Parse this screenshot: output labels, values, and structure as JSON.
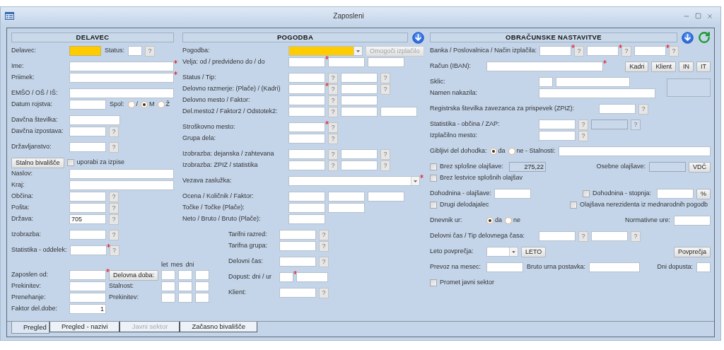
{
  "window": {
    "title": "Zaposleni"
  },
  "columns": [
    {
      "title": "DELAVEC",
      "groups": [
        {
          "kind": "plain",
          "rows": [
            {
              "label": "Delavec:",
              "items": [
                {
                  "kind": "smallbox",
                  "highlighted": true
                },
                {
                  "kind": "text",
                  "text": "Status:"
                },
                {
                  "kind": "minibox"
                },
                {
                  "kind": "help",
                  "label": "?"
                }
              ]
            }
          ]
        },
        {
          "kind": "plain",
          "rows": [
            {
              "label": "Ime:",
              "items": [
                {
                  "kind": "bar",
                  "required": true
                }
              ]
            },
            {
              "label": "Priimek:",
              "items": [
                {
                  "kind": "bar",
                  "required": true
                }
              ]
            }
          ]
        },
        {
          "kind": "plain",
          "rows": [
            {
              "label": "EMŠO / OŠ / IŠ:",
              "items": [
                {
                  "kind": "bar"
                }
              ]
            },
            {
              "label": "Datum rojstva:",
              "items": [
                {
                  "kind": "box"
                },
                {
                  "kind": "text",
                  "text": "Spol:"
                },
                {
                  "kind": "radio",
                  "label": "/",
                  "selected": false
                },
                {
                  "kind": "radio",
                  "label": "M",
                  "selected": true
                },
                {
                  "kind": "radio",
                  "label": "Ž",
                  "selected": false
                }
              ]
            }
          ]
        },
        {
          "kind": "plain",
          "rows": [
            {
              "label": "Davčna številka:",
              "items": [
                {
                  "kind": "midbox"
                }
              ]
            },
            {
              "label": "Davčna izpostava:",
              "items": [
                {
                  "kind": "box"
                },
                {
                  "kind": "help",
                  "label": "?"
                }
              ]
            }
          ]
        },
        {
          "kind": "plain",
          "rows": [
            {
              "label": "Državljanstvo:",
              "items": [
                {
                  "kind": "box"
                },
                {
                  "kind": "help",
                  "label": "?"
                }
              ]
            }
          ]
        },
        {
          "kind": "plain",
          "rows": [
            {
              "items": [
                {
                  "kind": "button",
                  "label": "Stalno bivališče"
                },
                {
                  "kind": "check",
                  "label": "uporabi za izpise",
                  "checked": false
                }
              ]
            },
            {
              "label": "Naslov:",
              "items": [
                {
                  "kind": "bar"
                }
              ]
            },
            {
              "label": "Kraj:",
              "items": [
                {
                  "kind": "bar"
                }
              ]
            },
            {
              "label": "Občina:",
              "items": [
                {
                  "kind": "box"
                },
                {
                  "kind": "help",
                  "label": "?"
                }
              ]
            },
            {
              "label": "Pošta:",
              "items": [
                {
                  "kind": "box"
                },
                {
                  "kind": "help",
                  "label": "?"
                }
              ]
            },
            {
              "label": "Država:",
              "items": [
                {
                  "kind": "box",
                  "value": "705"
                },
                {
                  "kind": "help",
                  "label": "?"
                }
              ]
            }
          ]
        },
        {
          "kind": "plain",
          "rows": [
            {
              "label": "Izobrazba:",
              "items": [
                {
                  "kind": "box"
                },
                {
                  "kind": "help",
                  "label": "?"
                }
              ]
            }
          ]
        },
        {
          "kind": "plain",
          "rows": [
            {
              "label": "Statistika - oddelek:",
              "items": [
                {
                  "kind": "box",
                  "required": true
                },
                {
                  "kind": "help",
                  "label": "?"
                }
              ]
            }
          ]
        },
        {
          "kind": "duration",
          "rows": [
            {
              "kind": "heads",
              "items": [
                {
                  "kind": "text",
                  "text": "let"
                },
                {
                  "kind": "text",
                  "text": "mes"
                },
                {
                  "kind": "text",
                  "text": "dni"
                }
              ]
            },
            {
              "kind": "line",
              "label": "Zaposlen od:",
              "items": [
                {
                  "kind": "box",
                  "required": true
                },
                {
                  "kind": "button",
                  "label": "Delovna doba:"
                },
                {
                  "kind": "minibox"
                },
                {
                  "kind": "minibox"
                },
                {
                  "kind": "minibox"
                }
              ]
            },
            {
              "kind": "line",
              "label": "Prekinitev:",
              "items": [
                {
                  "kind": "box"
                },
                {
                  "kind": "text",
                  "text": "Stalnost:"
                },
                {
                  "kind": "minibox"
                },
                {
                  "kind": "minibox"
                },
                {
                  "kind": "minibox"
                }
              ]
            },
            {
              "kind": "line",
              "label": "Prenehanje:",
              "items": [
                {
                  "kind": "box"
                },
                {
                  "kind": "text",
                  "text": "Prekinitev:"
                },
                {
                  "kind": "minibox"
                },
                {
                  "kind": "minibox"
                },
                {
                  "kind": "minibox"
                }
              ]
            },
            {
              "kind": "line",
              "label": "Faktor del.dobe:",
              "items": [
                {
                  "kind": "box",
                  "value": "1"
                }
              ]
            }
          ]
        }
      ]
    },
    {
      "title": "POGODBA",
      "header_icons": [
        {
          "kind": "down"
        }
      ],
      "groups": [
        {
          "kind": "plain",
          "rows": [
            {
              "label": "Pogodba:",
              "items": [
                {
                  "kind": "dropdown",
                  "highlighted": true
                },
                {
                  "kind": "button",
                  "label": "Omogoči izplačilo",
                  "disabled": true
                }
              ]
            },
            {
              "label": "Velja: od / predvideno do / do",
              "items": [
                {
                  "kind": "box",
                  "required": true
                },
                {
                  "kind": "box"
                },
                {
                  "kind": "box"
                }
              ]
            }
          ]
        },
        {
          "kind": "plain",
          "rows": [
            {
              "label": "Status / Tip:",
              "items": [
                {
                  "kind": "box"
                },
                {
                  "kind": "help",
                  "label": "?"
                },
                {
                  "kind": "box"
                },
                {
                  "kind": "help",
                  "label": "?"
                }
              ]
            },
            {
              "label": "Delovno razmerje: (Plače) / (Kadri)",
              "items": [
                {
                  "kind": "box",
                  "required": true
                },
                {
                  "kind": "help",
                  "label": "?"
                },
                {
                  "kind": "box"
                },
                {
                  "kind": "help",
                  "label": "?"
                }
              ]
            },
            {
              "label": "Delovno mesto / Faktor:",
              "items": [
                {
                  "kind": "box"
                },
                {
                  "kind": "help",
                  "label": "?"
                },
                {
                  "kind": "box"
                }
              ]
            },
            {
              "label": "Del.mesto2 / Faktor2 / Odstotek2:",
              "items": [
                {
                  "kind": "box"
                },
                {
                  "kind": "help",
                  "label": "?"
                },
                {
                  "kind": "box"
                },
                {
                  "kind": "box"
                }
              ]
            }
          ]
        },
        {
          "kind": "plain",
          "rows": [
            {
              "label": "Stroškovno mesto:",
              "items": [
                {
                  "kind": "box",
                  "required": true
                },
                {
                  "kind": "help",
                  "label": "?"
                }
              ]
            },
            {
              "label": "Grupa dela:",
              "items": [
                {
                  "kind": "box"
                },
                {
                  "kind": "help",
                  "label": "?"
                }
              ]
            }
          ]
        },
        {
          "kind": "plain",
          "rows": [
            {
              "label": "Izobrazba: dejanska / zahtevana",
              "items": [
                {
                  "kind": "box"
                },
                {
                  "kind": "help",
                  "label": "?"
                },
                {
                  "kind": "box"
                },
                {
                  "kind": "help",
                  "label": "?"
                }
              ]
            },
            {
              "label": "Izobrazba: ZPIZ / statistika",
              "items": [
                {
                  "kind": "box"
                },
                {
                  "kind": "help",
                  "label": "?"
                },
                {
                  "kind": "box"
                },
                {
                  "kind": "help",
                  "label": "?"
                }
              ]
            }
          ]
        },
        {
          "kind": "plain",
          "rows": [
            {
              "label": "Vezava zaslužka:",
              "items": [
                {
                  "kind": "widedropdown",
                  "required": true
                }
              ]
            }
          ]
        },
        {
          "kind": "plain",
          "rows": [
            {
              "label": "Ocena / Količnik / Faktor:",
              "items": [
                {
                  "kind": "box"
                },
                {
                  "kind": "box"
                },
                {
                  "kind": "box"
                }
              ]
            },
            {
              "label": "Točke / Točke (Plače):",
              "items": [
                {
                  "kind": "box"
                },
                {
                  "kind": "box"
                }
              ]
            },
            {
              "label": "Neto / Bruto / Bruto (Plače):",
              "items": [
                {
                  "kind": "box"
                }
              ]
            }
          ]
        },
        {
          "kind": "indented",
          "rows": [
            {
              "label": "Tarifni razred:",
              "items": [
                {
                  "kind": "box"
                },
                {
                  "kind": "help",
                  "label": "?"
                }
              ]
            },
            {
              "label": "Tarifna grupa:",
              "items": [
                {
                  "kind": "box"
                },
                {
                  "kind": "help",
                  "label": "?"
                }
              ]
            }
          ]
        },
        {
          "kind": "indented",
          "rows": [
            {
              "label": "Delovni čas:",
              "items": [
                {
                  "kind": "box"
                },
                {
                  "kind": "help",
                  "label": "?"
                }
              ]
            }
          ]
        },
        {
          "kind": "indented",
          "rows": [
            {
              "label": "Dopust: dni / ur",
              "items": [
                {
                  "kind": "minibox",
                  "required": true
                },
                {
                  "kind": "smallbox"
                }
              ]
            }
          ]
        },
        {
          "kind": "indented",
          "rows": [
            {
              "label": "Klient:",
              "items": [
                {
                  "kind": "box"
                },
                {
                  "kind": "help",
                  "label": "?"
                }
              ]
            }
          ]
        }
      ]
    },
    {
      "title": "OBRAČUNSKE NASTAVITVE",
      "header_icons": [
        {
          "kind": "down"
        },
        {
          "kind": "refresh"
        }
      ],
      "groups": [
        {
          "kind": "plain",
          "rows": [
            {
              "label": "Banka / Poslovalnica / Način izplačila:",
              "items": [
                {
                  "kind": "smallbox",
                  "required": true
                },
                {
                  "kind": "help",
                  "label": "?"
                },
                {
                  "kind": "smallbox",
                  "required": true
                },
                {
                  "kind": "help",
                  "label": "?"
                },
                {
                  "kind": "smallbox",
                  "required": true
                },
                {
                  "kind": "help",
                  "label": "?"
                }
              ]
            }
          ]
        },
        {
          "kind": "compact",
          "rows": [
            {
              "label": "Račun (IBAN):",
              "items": [
                {
                  "kind": "widebox",
                  "required": true
                }
              ],
              "end_items": [
                {
                  "kind": "button",
                  "label": "Kadri"
                },
                {
                  "kind": "button",
                  "label": "Klient"
                },
                {
                  "kind": "button",
                  "label": "IN"
                },
                {
                  "kind": "button",
                  "label": "IT"
                }
              ]
            }
          ]
        },
        {
          "kind": "boxed",
          "rows": [
            {
              "label": "Sklic:",
              "items": [
                {
                  "kind": "minibox"
                },
                {
                  "kind": "longbox"
                }
              ]
            },
            {
              "label": "Namen nakazila:",
              "items": [
                {
                  "kind": "widebox"
                }
              ]
            }
          ]
        },
        {
          "kind": "wide",
          "rows": [
            {
              "label": "Registrska številka zavezanca za prispevek (ZPIZ):",
              "items": [
                {
                  "kind": "box"
                },
                {
                  "kind": "help",
                  "label": "?"
                }
              ]
            }
          ]
        },
        {
          "kind": "plain",
          "rows": [
            {
              "label": "Statistika - občina / ZAP:",
              "items": [
                {
                  "kind": "box"
                },
                {
                  "kind": "help",
                  "label": "?"
                },
                {
                  "kind": "box",
                  "disabled": true
                },
                {
                  "kind": "help",
                  "label": "?",
                  "disabled": true
                }
              ]
            },
            {
              "label": "Izplačilno mesto:",
              "items": [
                {
                  "kind": "box"
                },
                {
                  "kind": "help",
                  "label": "?"
                }
              ]
            }
          ]
        },
        {
          "kind": "compact",
          "rows": [
            {
              "label": "Gibljivi del dohodka:",
              "items": [
                {
                  "kind": "radio",
                  "label": "da",
                  "selected": true
                },
                {
                  "kind": "radio",
                  "label": "ne - Stalnosti:",
                  "selected": false
                },
                {
                  "kind": "bar"
                }
              ]
            }
          ]
        },
        {
          "kind": "plain",
          "rows": [
            {
              "items": [
                {
                  "kind": "check",
                  "label": "Brez splošne olajšave:",
                  "checked": false
                },
                {
                  "kind": "box",
                  "value": "275,22",
                  "disabled": true
                }
              ],
              "end_items": [
                {
                  "kind": "text",
                  "text": "Osebne olajšave:"
                },
                {
                  "kind": "box",
                  "disabled": true
                },
                {
                  "kind": "button",
                  "label": "VDČ"
                }
              ]
            },
            {
              "items": [
                {
                  "kind": "check",
                  "label": "Brez lestvice splošnih olajšav",
                  "checked": false
                }
              ]
            }
          ]
        },
        {
          "kind": "compact",
          "rows": [
            {
              "label": "Dohodnina - olajšave:",
              "items": [
                {
                  "kind": "box"
                }
              ],
              "end_items": [
                {
                  "kind": "check",
                  "label": "Dohodnina - stopnja:",
                  "checked": false
                },
                {
                  "kind": "box"
                },
                {
                  "kind": "button",
                  "label": "%"
                }
              ]
            },
            {
              "items": [
                {
                  "kind": "check",
                  "label": "Drugi delodajalec",
                  "checked": false
                }
              ],
              "end_items": [
                {
                  "kind": "check",
                  "label": "Olajšava nerezidenta iz mednarodnih pogodb",
                  "checked": false
                }
              ]
            }
          ]
        },
        {
          "kind": "compact",
          "rows": [
            {
              "label": "Dnevnik ur:",
              "items": [
                {
                  "kind": "radio",
                  "label": "da",
                  "selected": true
                },
                {
                  "kind": "radio",
                  "label": "ne",
                  "selected": false
                }
              ],
              "end_items": [
                {
                  "kind": "text",
                  "text": "Normativne ure:"
                },
                {
                  "kind": "box"
                }
              ]
            }
          ]
        },
        {
          "kind": "plain",
          "rows": [
            {
              "label": "Delovni čas / Tip delovnega časa:",
              "items": [
                {
                  "kind": "box"
                },
                {
                  "kind": "help",
                  "label": "?"
                },
                {
                  "kind": "box"
                },
                {
                  "kind": "help",
                  "label": "?"
                }
              ]
            }
          ]
        },
        {
          "kind": "compact",
          "rows": [
            {
              "label": "Leto povprečja:",
              "items": [
                {
                  "kind": "combo"
                },
                {
                  "kind": "button",
                  "label": "LETO"
                }
              ],
              "end_items": [
                {
                  "kind": "button",
                  "label": "Povprečja"
                }
              ]
            }
          ]
        },
        {
          "kind": "compact",
          "rows": [
            {
              "label": "Prevoz na mesec:",
              "items": [
                {
                  "kind": "box"
                },
                {
                  "kind": "text",
                  "text": "Bruto urna postavka:"
                },
                {
                  "kind": "midbox"
                }
              ],
              "end_items": [
                {
                  "kind": "text",
                  "text": "Dni dopusta:"
                },
                {
                  "kind": "minibox"
                }
              ]
            }
          ]
        },
        {
          "kind": "plain",
          "rows": [
            {
              "items": [
                {
                  "kind": "check",
                  "label": "Promet javni sektor",
                  "checked": false
                }
              ]
            }
          ]
        }
      ]
    }
  ],
  "tabs": [
    {
      "label": "Pregled",
      "selected": true,
      "disabled": false
    },
    {
      "label": "Pregled - nazivi",
      "selected": false,
      "disabled": false
    },
    {
      "label": "Javni sektor",
      "selected": false,
      "disabled": true
    },
    {
      "label": "Začasno bivališče",
      "selected": false,
      "disabled": false
    }
  ]
}
